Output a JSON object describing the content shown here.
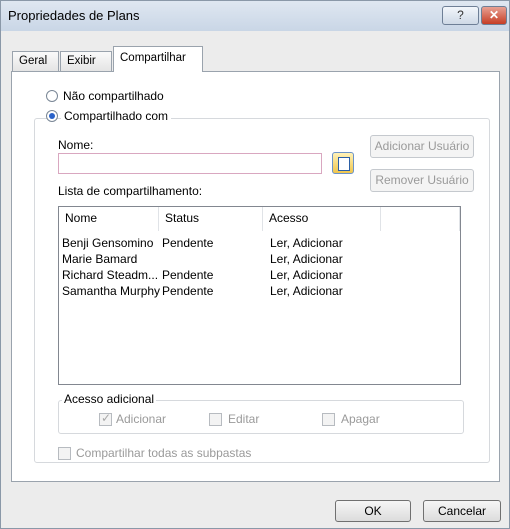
{
  "window": {
    "title": "Propriedades de Plans",
    "help_label": "?",
    "close_label": "✕"
  },
  "tabs": [
    {
      "label": "Geral"
    },
    {
      "label": "Exibir"
    },
    {
      "label": "Compartilhar"
    }
  ],
  "sharing": {
    "not_shared_label": "Não compartilhado",
    "shared_with_label": "Compartilhado com",
    "name_label": "Nome:",
    "name_value": "",
    "add_user_label": "Adicionar Usuário",
    "remove_user_label": "Remover Usuário",
    "share_list_label": "Lista de compartilhamento:",
    "columns": [
      "Nome",
      "Status",
      "Acesso",
      ""
    ],
    "rows": [
      {
        "name": "Benji Gensomino",
        "status": "Pendente",
        "access": "Ler, Adicionar"
      },
      {
        "name": "Marie Bamard",
        "status": "",
        "access": "Ler, Adicionar"
      },
      {
        "name": "Richard Steadm...",
        "status": "Pendente",
        "access": "Ler, Adicionar"
      },
      {
        "name": "Samantha Murphy",
        "status": "Pendente",
        "access": "Ler, Adicionar"
      }
    ],
    "extra_access": {
      "legend": "Acesso adicional",
      "add_label": "Adicionar",
      "add_checked": true,
      "edit_label": "Editar",
      "edit_checked": false,
      "delete_label": "Apagar",
      "delete_checked": false
    },
    "share_subfolders_label": "Compartilhar todas as subpastas"
  },
  "footer": {
    "ok_label": "OK",
    "cancel_label": "Cancelar"
  }
}
